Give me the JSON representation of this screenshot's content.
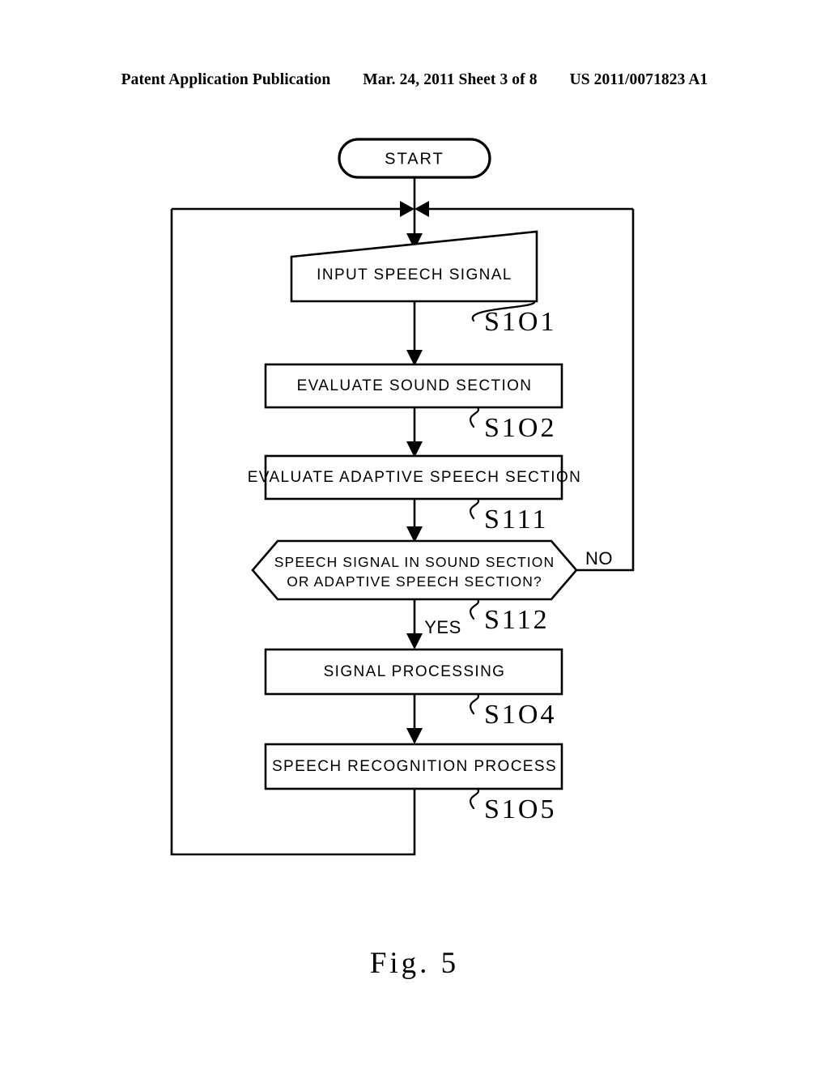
{
  "header": {
    "publication": "Patent Application Publication",
    "date_sheet": "Mar. 24, 2011  Sheet 3 of 8",
    "patent_number": "US 2011/0071823 A1"
  },
  "figure": {
    "caption": "Fig.  5"
  },
  "flowchart": {
    "start_label": "START",
    "nodes": [
      {
        "id": "s101",
        "shape": "parallelogram-input",
        "text": "INPUT SPEECH SIGNAL",
        "step": "S1O1"
      },
      {
        "id": "s102",
        "shape": "rectangle",
        "text": "EVALUATE SOUND SECTION",
        "step": "S1O2"
      },
      {
        "id": "s111",
        "shape": "rectangle",
        "text": "EVALUATE ADAPTIVE SPEECH SECTION",
        "step": "S111"
      },
      {
        "id": "s112",
        "shape": "hexagon-decision",
        "text_line1": "SPEECH SIGNAL IN SOUND SECTION",
        "text_line2": "OR ADAPTIVE SPEECH SECTION?",
        "step": "S112",
        "branch_yes": "YES",
        "branch_no": "NO"
      },
      {
        "id": "s104",
        "shape": "rectangle",
        "text": "SIGNAL PROCESSING",
        "step": "S1O4"
      },
      {
        "id": "s105",
        "shape": "rectangle",
        "text": "SPEECH RECOGNITION PROCESS",
        "step": "S1O5"
      }
    ]
  },
  "colors": {
    "ink": "#000000",
    "paper": "#ffffff"
  }
}
